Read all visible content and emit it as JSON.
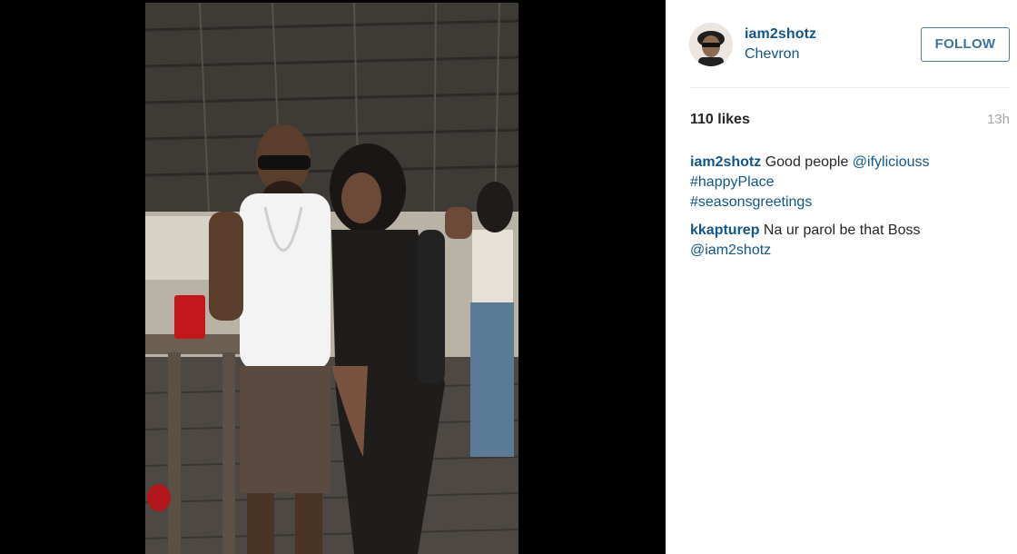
{
  "post": {
    "username": "iam2shotz",
    "location": "Chevron",
    "follow_label": "FOLLOW",
    "likes": "110 likes",
    "time": "13h"
  },
  "comments": [
    {
      "user": "iam2shotz",
      "text": "Good people",
      "mention": "@ifyliciouss",
      "tags": [
        "#happyPlace",
        "#seasonsgreetings"
      ]
    },
    {
      "user": "kkapturep",
      "text": "Na ur parol be that Boss",
      "mention": "@iam2shotz"
    }
  ],
  "colors": {
    "link": "#125688",
    "text": "#262626",
    "muted": "#a5a7aa",
    "follow_border": "#4e7fa8"
  }
}
